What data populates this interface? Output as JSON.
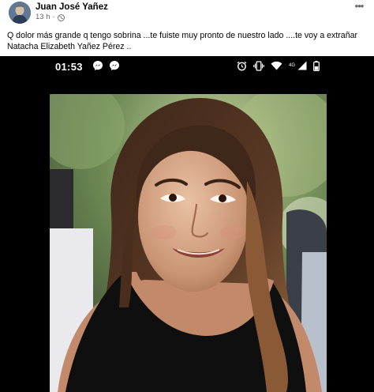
{
  "post": {
    "author": "Juan José Yañez",
    "time": "13 h",
    "audience_icon": "globe-icon",
    "more_icon": "more-options-icon",
    "caption_lines": [
      "Q dolor más  grande q tengo sobrina ...te fuiste muy pronto de nuestro lado ....te voy a extrañar",
      "Natacha Elizabeth Yañez Pérez  .."
    ]
  },
  "phone_status": {
    "time": "01:53",
    "left_icons": [
      "messenger-icon",
      "messenger-icon"
    ],
    "right_icons": [
      "alarm-icon",
      "vibrate-icon",
      "wifi-icon",
      "signal-icon",
      "battery-icon"
    ],
    "network_label": "4G"
  },
  "photo": {
    "description_icon": "portrait-photo"
  },
  "colors": {
    "text": "#050505",
    "secondary_text": "#65676b",
    "media_background": "#000000"
  }
}
